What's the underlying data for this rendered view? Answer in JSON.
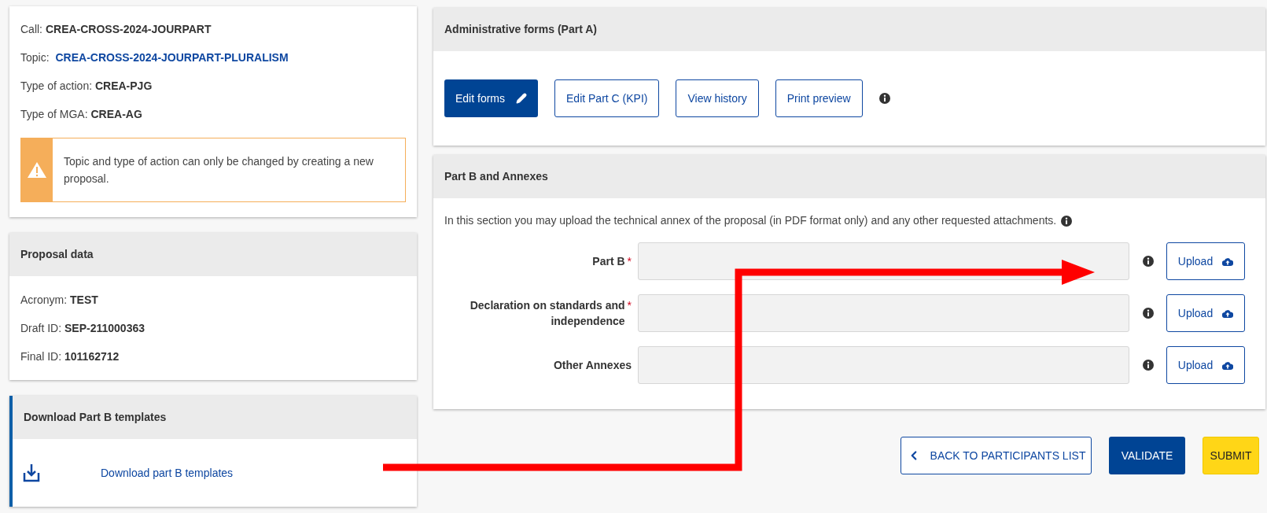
{
  "call_info": {
    "rows": [
      {
        "label": "Call:",
        "value": "CREA-CROSS-2024-JOURPART",
        "kind": "bold"
      },
      {
        "label": "Topic:",
        "value": "CREA-CROSS-2024-JOURPART-PLURALISM",
        "kind": "link"
      },
      {
        "label": "Type of action:",
        "value": "CREA-PJG",
        "kind": "bold"
      },
      {
        "label": "Type of MGA:",
        "value": "CREA-AG",
        "kind": "bold"
      }
    ],
    "warning": "Topic and type of action can only be changed by creating a new proposal."
  },
  "proposal_data": {
    "title": "Proposal data",
    "rows": [
      {
        "label": "Acronym:",
        "value": "TEST",
        "kind": "bold"
      },
      {
        "label": "Draft ID:",
        "value": "SEP-211000363",
        "kind": "bold"
      },
      {
        "label": "Final ID:",
        "value": "101162712",
        "kind": "bold"
      }
    ]
  },
  "templates": {
    "title": "Download Part B templates",
    "link": "Download part B templates"
  },
  "admin_forms": {
    "title": "Administrative forms (Part A)",
    "buttons": [
      {
        "label": "Edit forms",
        "kind": "primary"
      },
      {
        "label": "Edit Part C (KPI)",
        "kind": "outline"
      },
      {
        "label": "View history",
        "kind": "outline"
      },
      {
        "label": "Print preview",
        "kind": "outline"
      }
    ]
  },
  "part_b": {
    "title": "Part B and Annexes",
    "required_mark": "*",
    "intro": "In this section you may upload the technical annex of the proposal (in PDF format only) and any other requested attachments.",
    "fields": [
      {
        "label": "Part B",
        "required": true,
        "button": "Upload"
      },
      {
        "label": "Declaration on standards and independence",
        "required": true,
        "button": "Upload"
      },
      {
        "label": "Other Annexes",
        "required": false,
        "button": "Upload"
      }
    ]
  },
  "actions": [
    {
      "label": "BACK TO PARTICIPANTS LIST",
      "kind": "back"
    },
    {
      "label": "VALIDATE",
      "kind": "primary"
    },
    {
      "label": "SUBMIT",
      "kind": "submit"
    }
  ]
}
